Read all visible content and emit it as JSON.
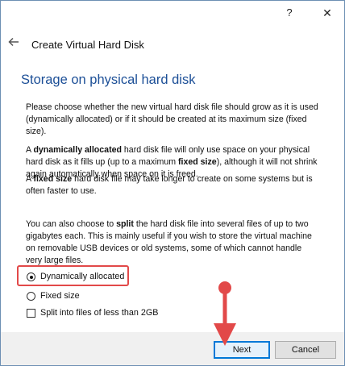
{
  "window": {
    "help_label": "?",
    "close_label": "✕"
  },
  "header": {
    "back_icon": "back-arrow-icon",
    "title": "Create Virtual Hard Disk"
  },
  "main": {
    "heading": "Storage on physical hard disk",
    "paragraph1": "Please choose whether the new virtual hard disk file should grow as it is used (dynamically allocated) or if it should be created at its maximum size (fixed size).",
    "paragraph2": {
      "pre": "A ",
      "bold1": "dynamically allocated",
      "mid": " hard disk file will only use space on your physical hard disk as it fills up (up to a maximum ",
      "bold2": "fixed size",
      "post": "), although it will not shrink again automatically when space on it is freed."
    },
    "paragraph3": {
      "pre": "A ",
      "bold": "fixed size",
      "post": " hard disk file may take longer to create on some systems but is often faster to use."
    },
    "paragraph4": {
      "pre": "You can also choose to ",
      "bold": "split",
      "post": " the hard disk file into several files of up to two gigabytes each. This is mainly useful if you wish to store the virtual machine on removable USB devices or old systems, some of which cannot handle very large files."
    },
    "options": {
      "dynamic_label": "Dynamically allocated",
      "dynamic_selected": true,
      "fixed_label": "Fixed size",
      "fixed_selected": false,
      "split_label": "Split into files of less than 2GB",
      "split_checked": false
    }
  },
  "footer": {
    "next_label": "Next",
    "cancel_label": "Cancel"
  },
  "annotations": {
    "highlight_color": "#e24949",
    "arrow_color": "#e24949"
  }
}
